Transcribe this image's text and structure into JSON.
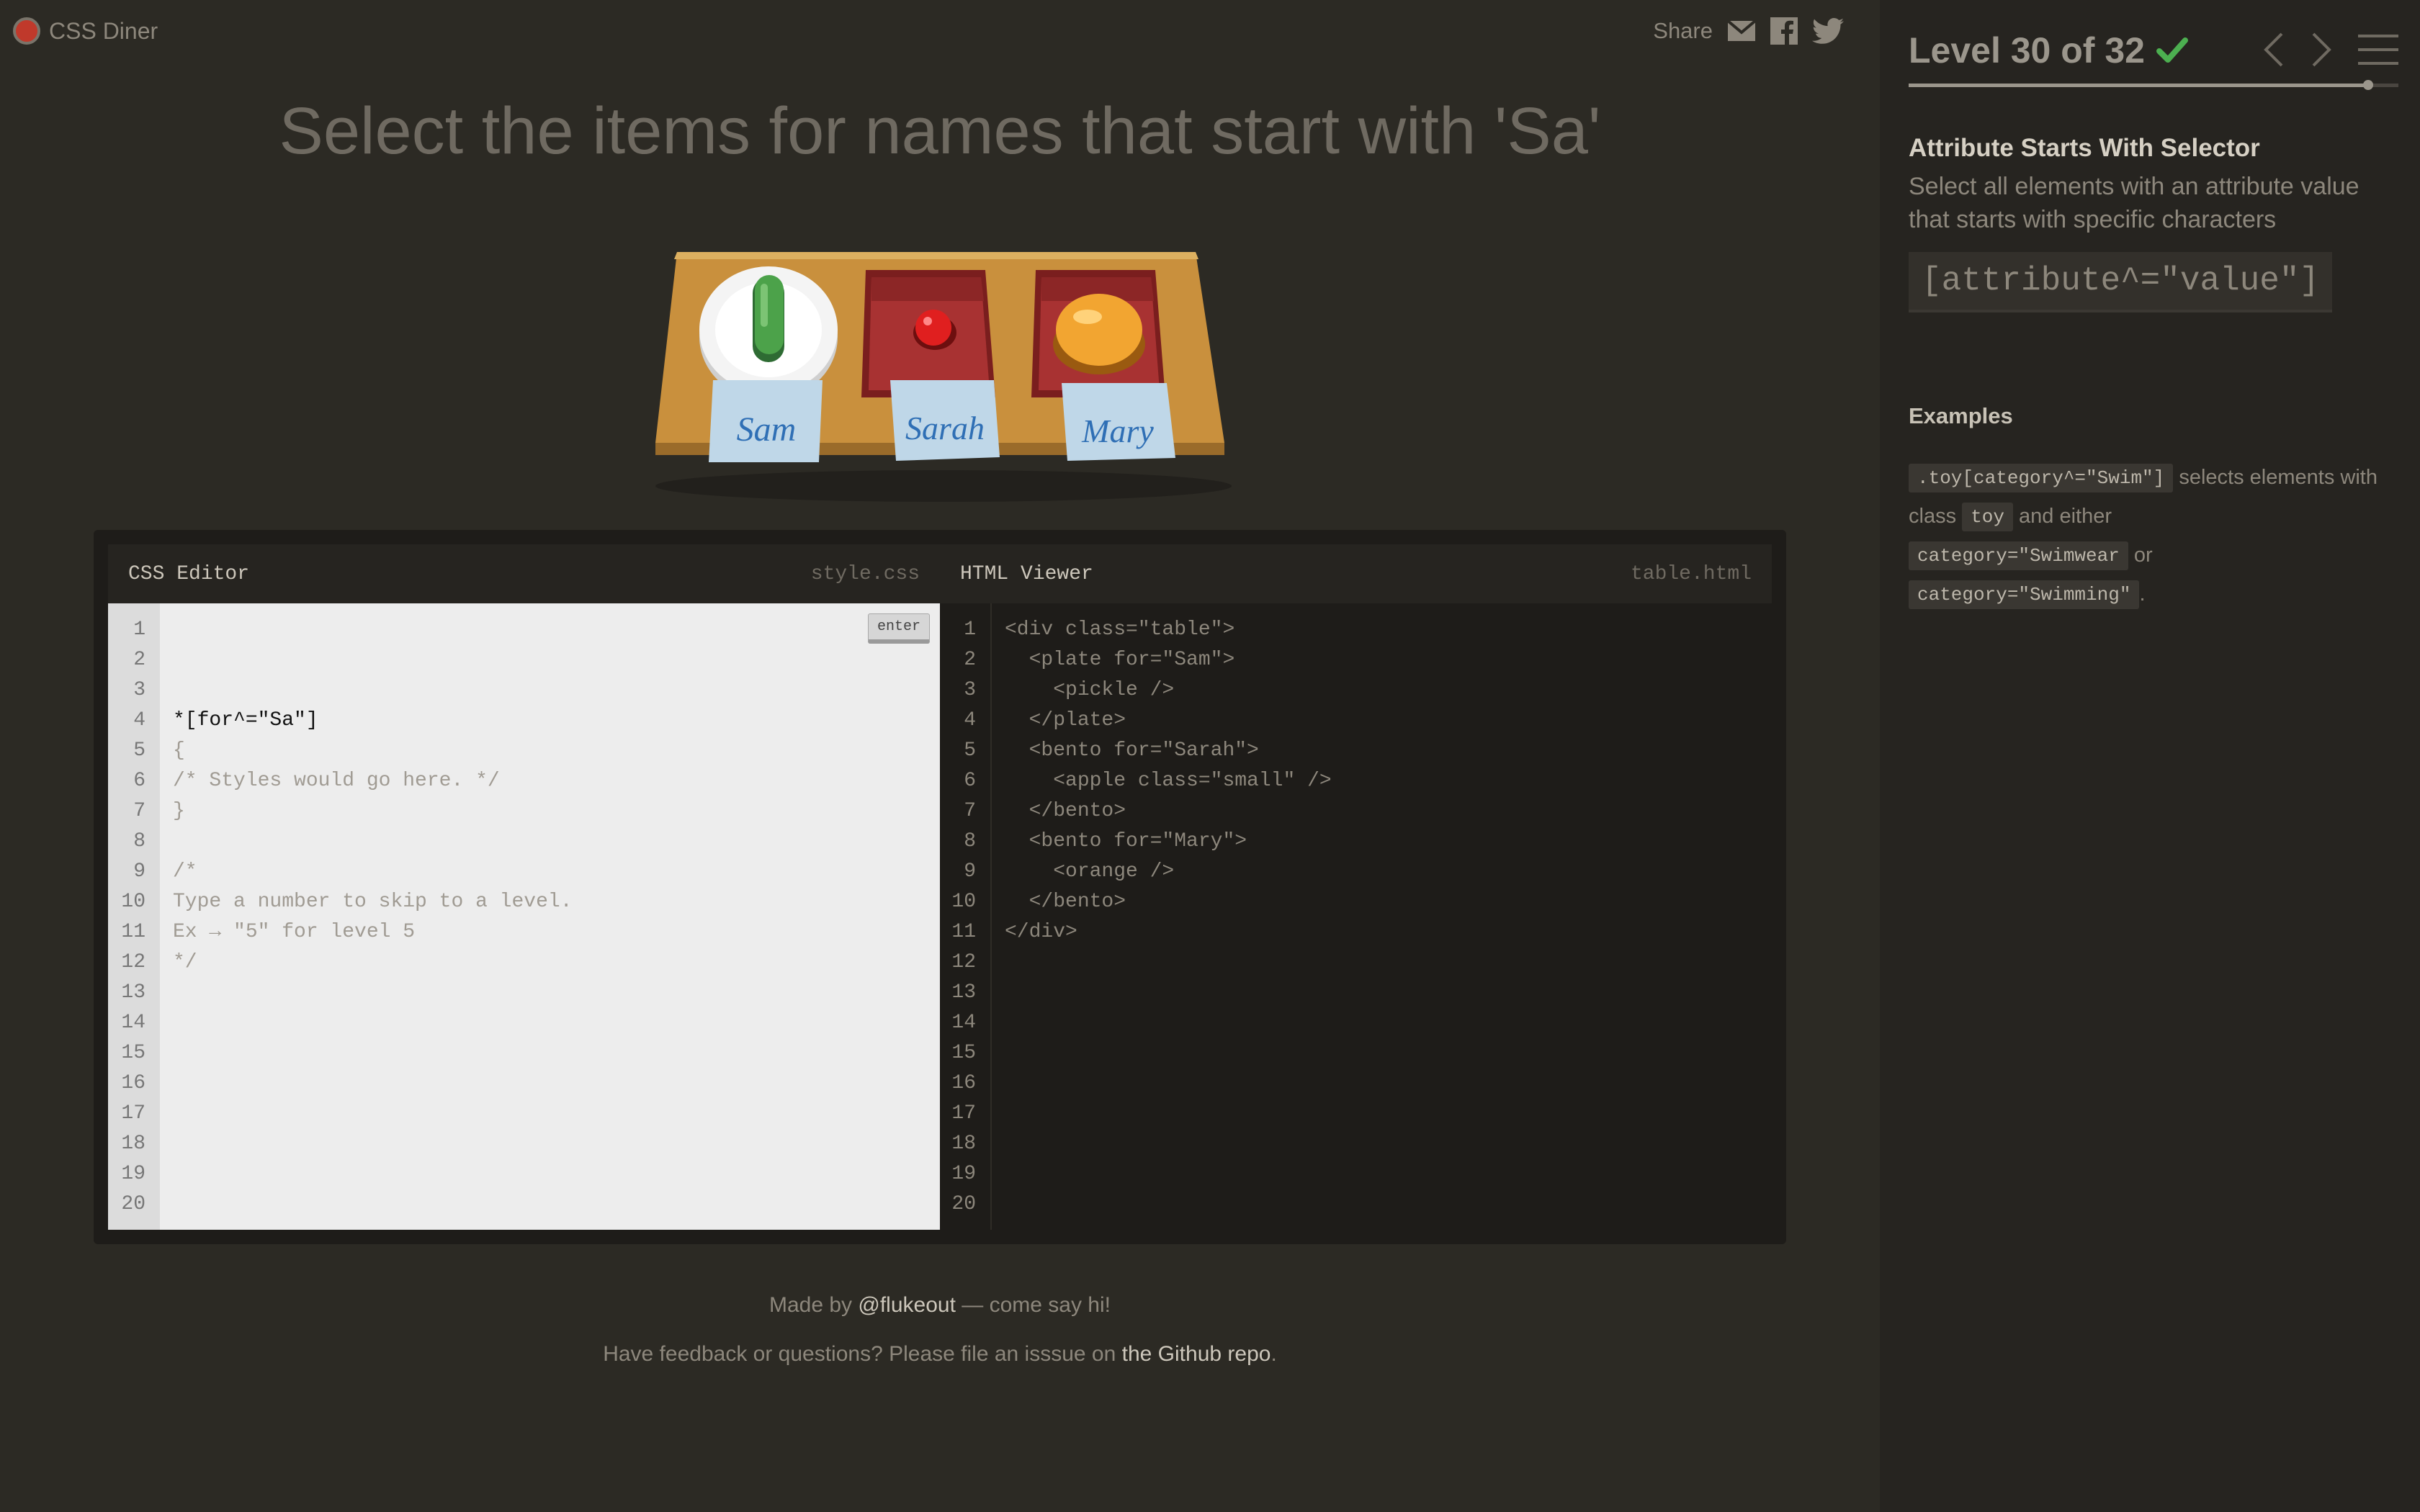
{
  "app": {
    "name": "CSS Diner"
  },
  "share": {
    "label": "Share",
    "icons": [
      "mail-icon",
      "facebook-icon",
      "twitter-icon"
    ]
  },
  "level": {
    "instruction": "Select the items for names that start with 'Sa'",
    "indicator": "Level 30 of 32",
    "current": 30,
    "total": 32,
    "completed": true
  },
  "table": {
    "plates": [
      {
        "name": "Sam",
        "kind": "plate",
        "item": "pickle"
      },
      {
        "name": "Sarah",
        "kind": "bento",
        "item": "small apple"
      },
      {
        "name": "Mary",
        "kind": "bento",
        "item": "orange"
      }
    ]
  },
  "editor": {
    "css_title": "CSS Editor",
    "css_file": "style.css",
    "enter_label": "enter",
    "css_input": "*[for^=\"Sa\"]",
    "css_lines": [
      "",
      "{",
      "/* Styles would go here. */",
      "}",
      "",
      "/*",
      "Type a number to skip to a level.",
      "Ex → \"5\" for level 5",
      "*/",
      "",
      "",
      "",
      "",
      "",
      "",
      "",
      "",
      "",
      "",
      ""
    ],
    "html_title": "HTML Viewer",
    "html_file": "table.html",
    "html_lines": [
      "<div class=\"table\">",
      "  <plate for=\"Sam\">",
      "    <pickle />",
      "  </plate>",
      "  <bento for=\"Sarah\">",
      "    <apple class=\"small\" />",
      "  </bento>",
      "  <bento for=\"Mary\">",
      "    <orange />",
      "  </bento>",
      "</div>"
    ],
    "line_numbers": [
      "1",
      "2",
      "3",
      "4",
      "5",
      "6",
      "7",
      "8",
      "9",
      "10",
      "11",
      "12",
      "13",
      "14",
      "15",
      "16",
      "17",
      "18",
      "19",
      "20"
    ]
  },
  "footer": {
    "line1_prefix": "Made by ",
    "line1_link": "@flukeout",
    "line1_suffix": " — come say hi!",
    "line2_prefix": "Have feedback or questions? Please file an isssue on ",
    "line2_link": "the Github repo",
    "line2_suffix": "."
  },
  "sidebar": {
    "selector_name": "Attribute Starts With Selector",
    "selector_desc": "Select all elements with an attribute value that starts with specific characters",
    "syntax": "[attribute^=\"value\"]",
    "examples_title": "Examples",
    "example": {
      "code1": ".toy[category^=\"Swim\"]",
      "t1": "selects elements with class",
      "code2": "toy",
      "t2": "and either",
      "code3": "category=\"Swimwear",
      "t3": "or",
      "code4": "category=\"Swimming\"",
      "t4": "."
    }
  },
  "colors": {
    "accent_check": "#4caf50",
    "plate_label": "#2f6fb5"
  }
}
